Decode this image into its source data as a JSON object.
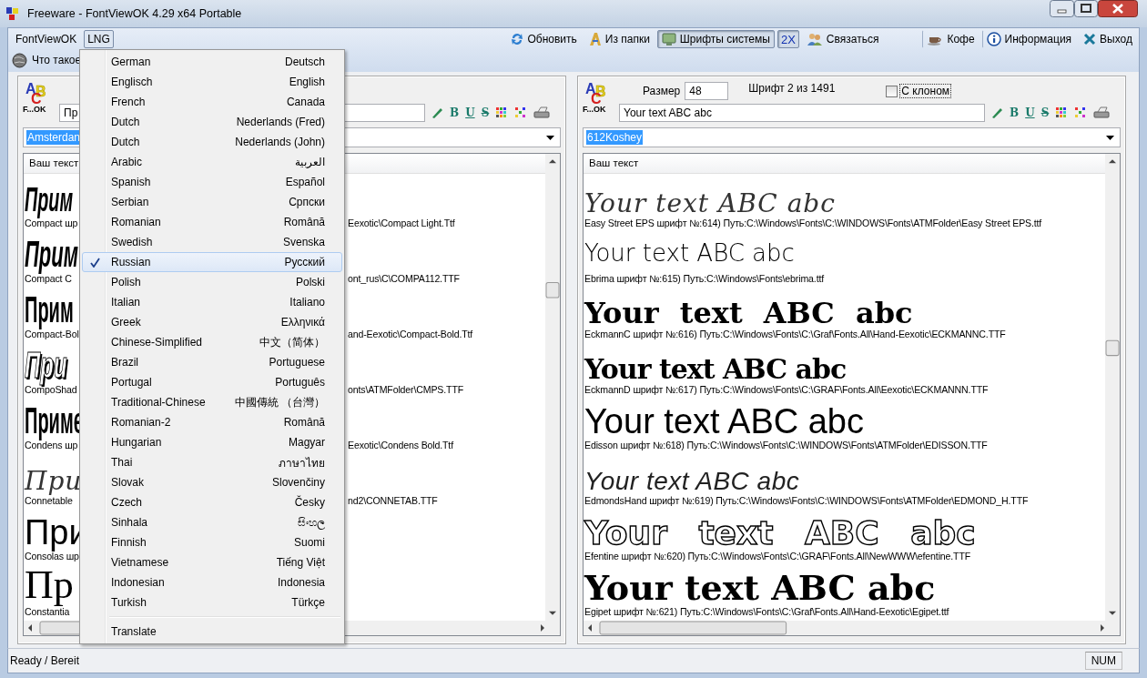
{
  "window": {
    "title": "Freeware - FontViewOK 4.29 x64 Portable"
  },
  "menu_bar": [
    {
      "label": "FontViewOK",
      "open": false
    },
    {
      "label": "LNG",
      "open": true
    }
  ],
  "toolbar": [
    {
      "label": "Обновить",
      "kind": "refresh",
      "pressed": false
    },
    {
      "label": "Из папки",
      "kind": "folder",
      "pressed": false
    },
    {
      "label": "Шрифты системы",
      "kind": "monitor",
      "pressed": true
    },
    {
      "label": "2X",
      "kind": "text",
      "pressed": true
    },
    {
      "label": "Связаться",
      "kind": "people",
      "pressed": false
    },
    {
      "label": "Кофе",
      "kind": "cup",
      "pressed": false
    },
    {
      "label": "Информация",
      "kind": "info",
      "pressed": false
    },
    {
      "label": "Выход",
      "kind": "exit",
      "pressed": false
    }
  ],
  "toolbar_row2": {
    "label": "Что такое"
  },
  "language_menu": {
    "items": [
      {
        "name": "German",
        "native": "Deutsch",
        "selected": false
      },
      {
        "name": "Englisch",
        "native": "English",
        "selected": false
      },
      {
        "name": "French",
        "native": "Canada",
        "selected": false
      },
      {
        "name": "Dutch",
        "native": "Nederlands (Fred)",
        "selected": false
      },
      {
        "name": "Dutch",
        "native": "Nederlands (John)",
        "selected": false
      },
      {
        "name": "Arabic",
        "native": "العربية",
        "selected": false
      },
      {
        "name": "Spanish",
        "native": "Español",
        "selected": false
      },
      {
        "name": "Serbian",
        "native": "Српски",
        "selected": false
      },
      {
        "name": "Romanian",
        "native": "Română",
        "selected": false
      },
      {
        "name": "Swedish",
        "native": "Svenska",
        "selected": false
      },
      {
        "name": "Russian",
        "native": "Русский",
        "selected": true
      },
      {
        "name": "Polish",
        "native": "Polski",
        "selected": false
      },
      {
        "name": "Italian",
        "native": "Italiano",
        "selected": false
      },
      {
        "name": "Greek",
        "native": "Ελληνικά",
        "selected": false
      },
      {
        "name": "Chinese-Simplified",
        "native": "中文（简体）",
        "selected": false
      },
      {
        "name": "Brazil",
        "native": "Portuguese",
        "selected": false
      },
      {
        "name": "Portugal",
        "native": "Português",
        "selected": false
      },
      {
        "name": "Traditional-Chinese",
        "native": "中國傳統 （台灣）",
        "selected": false
      },
      {
        "name": "Romanian-2",
        "native": "Română",
        "selected": false
      },
      {
        "name": "Hungarian",
        "native": "Magyar",
        "selected": false
      },
      {
        "name": "Thai",
        "native": "ภาษาไทย",
        "selected": false
      },
      {
        "name": "Slovak",
        "native": "Slovenčiny",
        "selected": false
      },
      {
        "name": "Czech",
        "native": "Česky",
        "selected": false
      },
      {
        "name": "Sinhala",
        "native": "සිංහල",
        "selected": false
      },
      {
        "name": "Finnish",
        "native": "Suomi",
        "selected": false
      },
      {
        "name": "Vietnamese",
        "native": "Tiếng Việt",
        "selected": false
      },
      {
        "name": "Indonesian",
        "native": "Indonesia",
        "selected": false
      },
      {
        "name": "Turkish",
        "native": "Türkçe",
        "selected": false
      }
    ],
    "footer": "Translate"
  },
  "left_panel": {
    "logo": {
      "letters": [
        "A",
        "B",
        "C"
      ],
      "caption": "F...OK"
    },
    "text_field": "Пр",
    "format_buttons": [
      "B",
      "U",
      "S"
    ],
    "font_combo": {
      "value": "Amsterdan",
      "text_selected": true
    },
    "list_header": "Ваш текст",
    "rows": [
      {
        "kind": "condensed-italic",
        "sample": "Прим",
        "caption_start": "Compact шр",
        "caption_end": "Eexotic\\Compact Light.Ttf"
      },
      {
        "kind": "condensed-bold-italic",
        "sample": "Прим",
        "caption_start": "Compact C",
        "caption_end": "ont_rus\\C\\COMPA112.TTF"
      },
      {
        "kind": "condensed-bold",
        "sample": "Прим",
        "caption_start": "Compact-Bol",
        "caption_end": "and-Eexotic\\Compact-Bold.Ttf"
      },
      {
        "kind": "shadow",
        "sample": "При",
        "caption_start": "CompoShad",
        "caption_end": "onts\\ATMFolder\\CMPS.TTF"
      },
      {
        "kind": "condensed-bold",
        "sample": "Приме",
        "caption_start": "Condens шр",
        "caption_end": "Eexotic\\Condens Bold.Ttf"
      },
      {
        "kind": "script",
        "sample": "При",
        "caption_start": "Connetable",
        "caption_end": "nd2\\CONNETAB.TTF"
      },
      {
        "kind": "sans",
        "sample": "При",
        "caption_start": "Consolas шр"
      },
      {
        "kind": "serif",
        "sample": "Пр",
        "caption_start": "Constantia"
      }
    ]
  },
  "right_panel": {
    "logo": {
      "letters": [
        "A",
        "B",
        "C"
      ],
      "caption": "F...OK"
    },
    "size_label": "Размер",
    "size_value": "48",
    "font_counter": "Шрифт 2 из 1491",
    "clone_checkbox": {
      "label": "С клоном",
      "checked": false
    },
    "text_field": "Your text ABC abc",
    "format_buttons": [
      "B",
      "U",
      "S"
    ],
    "font_combo": {
      "value": "612Koshey",
      "text_selected": true
    },
    "list_header": "Ваш текст",
    "rows": [
      {
        "kind": "script",
        "sample": "Your text ABC abc",
        "caption": "Easy Street EPS шрифт №:614) Путь:C:\\Windows\\Fonts\\C:\\WINDOWS\\Fonts\\ATMFolder\\Easy Street EPS.ttf"
      },
      {
        "kind": "light",
        "sample": "Your text ABC abc",
        "caption": "Ebrima шрифт №:615) Путь:C:\\Windows\\Fonts\\ebrima.ttf"
      },
      {
        "kind": "blackletter-wide",
        "sample": "Your text ABC abc",
        "caption": "EckmannC шрифт №:616) Путь:C:\\Windows\\Fonts\\C:\\Graf\\Fonts.All\\Hand-Eexotic\\ECKMANNC.TTF"
      },
      {
        "kind": "blackletter",
        "sample": "Your text ABC abc",
        "caption": "EckmannD шрифт №:617) Путь:C:\\Windows\\Fonts\\C:\\GRAF\\Fonts.All\\Eexotic\\ECKMANNN.TTF"
      },
      {
        "kind": "sans",
        "sample": "Your text ABC abc",
        "caption": "Edisson шрифт №:618) Путь:C:\\Windows\\Fonts\\C:\\WINDOWS\\Fonts\\ATMFolder\\EDISSON.TTF"
      },
      {
        "kind": "hand",
        "sample": "Your text ABC abc",
        "caption": "EdmondsHand шрифт №:619) Путь:C:\\Windows\\Fonts\\C:\\WINDOWS\\Fonts\\ATMFolder\\EDMOND_H.TTF"
      },
      {
        "kind": "outline",
        "sample": "Your text ABC abc",
        "caption": "Efentine шрифт №:620) Путь:C:\\Windows\\Fonts\\C:\\GRAF\\Fonts.All\\NewWWW\\efentine.TTF"
      },
      {
        "kind": "slab",
        "sample": "Your text ABC abc",
        "caption": "Egipet шрифт №:621) Путь:C:\\Windows\\Fonts\\C:\\Graf\\Fonts.All\\Hand-Eexotic\\Egipet.ttf"
      }
    ]
  },
  "status_bar": {
    "text": "Ready / Bereit",
    "indicator": "NUM"
  }
}
